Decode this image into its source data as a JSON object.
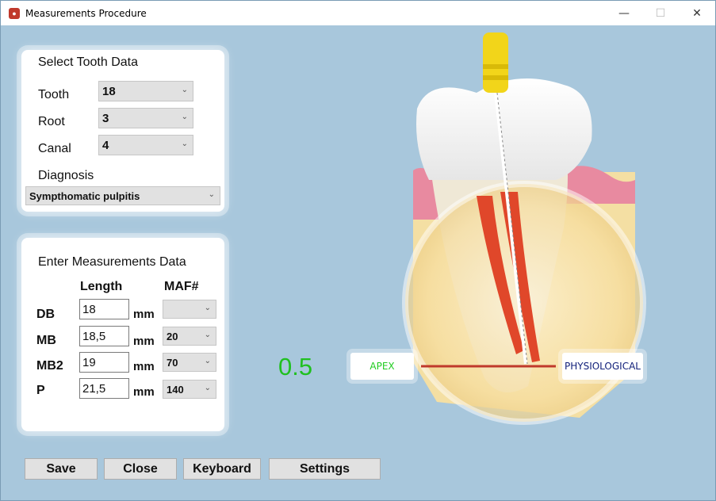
{
  "window": {
    "title": "Measurements Procedure",
    "minimize": "—",
    "maximize": "☐",
    "close": "✕"
  },
  "tooth_panel": {
    "title": "Select Tooth Data",
    "tooth_label": "Tooth",
    "tooth_value": "18",
    "root_label": "Root",
    "root_value": "3",
    "canal_label": "Canal",
    "canal_value": "4",
    "diagnosis_label": "Diagnosis",
    "diagnosis_value": "Sympthomatic pulpitis"
  },
  "measure_panel": {
    "title": "Enter Measurements Data",
    "col_length": "Length",
    "col_maf": "MAF#",
    "unit": "mm",
    "rows": [
      {
        "label": "DB",
        "length": "18",
        "maf": ""
      },
      {
        "label": "MB",
        "length": "18,5",
        "maf": "20"
      },
      {
        "label": "MB2",
        "length": "19",
        "maf": "70"
      },
      {
        "label": "P",
        "length": "21,5",
        "maf": "140"
      }
    ]
  },
  "buttons": {
    "save": "Save",
    "close": "Close",
    "keyboard": "Keyboard",
    "settings": "Settings"
  },
  "readout": {
    "value": "0.5"
  },
  "indicators": {
    "apex": "APEX",
    "physiological": "PHYSIOLOGICAL"
  },
  "icons": {
    "app": "tooth-icon",
    "chevron": "chevron-down-icon"
  },
  "colors": {
    "background": "#a8c7dc",
    "readout": "#20c020",
    "apex_text": "#22cc22",
    "phys_text": "#12207a",
    "canal": "#e0472a"
  }
}
